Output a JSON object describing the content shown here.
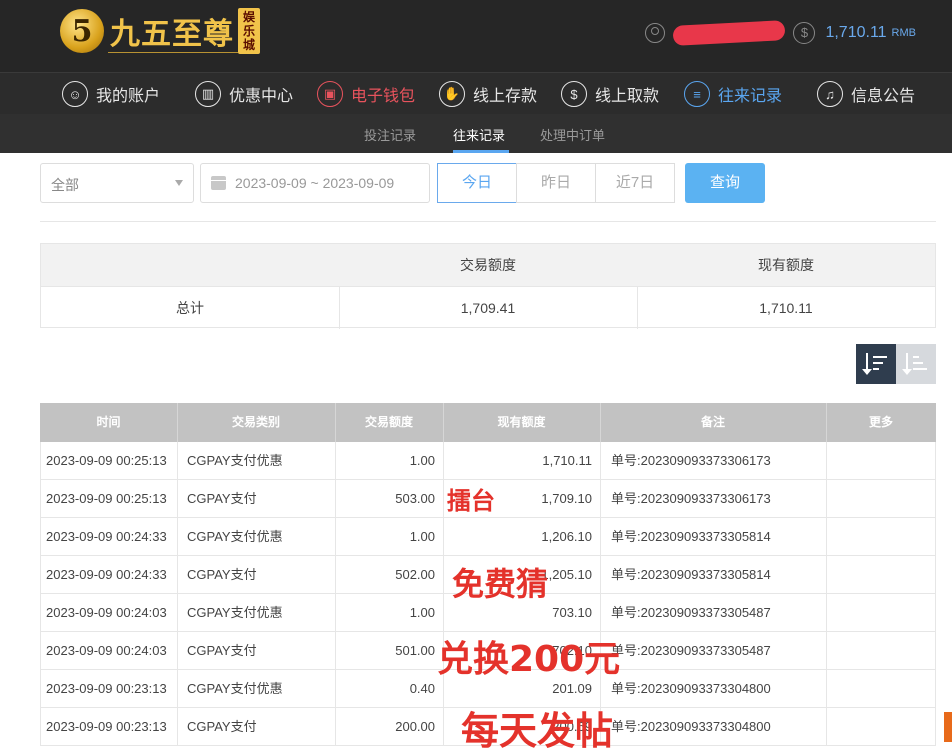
{
  "header": {
    "logo_mark": "5",
    "logo_text": "九五至尊",
    "logo_tag": "娱乐城",
    "balance": "1,710.11",
    "balance_unit": "RMB"
  },
  "nav": [
    {
      "label": "我的账户",
      "icon": "user-icon"
    },
    {
      "label": "优惠中心",
      "icon": "gift-icon"
    },
    {
      "label": "电子钱包",
      "icon": "wallet-icon"
    },
    {
      "label": "线上存款",
      "icon": "deposit-icon"
    },
    {
      "label": "线上取款",
      "icon": "withdraw-icon"
    },
    {
      "label": "往来记录",
      "icon": "record-icon"
    },
    {
      "label": "信息公告",
      "icon": "bell-icon"
    }
  ],
  "subnav": [
    "投注记录",
    "往来记录",
    "处理中订单"
  ],
  "filter": {
    "type_value": "全部",
    "date_range": "2023-09-09 ~ 2023-09-09",
    "today": "今日",
    "yesterday": "昨日",
    "last7": "近7日",
    "query": "查询"
  },
  "summary": {
    "headers": [
      "",
      "交易额度",
      "现有额度"
    ],
    "total_label": "总计",
    "trade_amount": "1,709.41",
    "current_amount": "1,710.11"
  },
  "table": {
    "headers": [
      "时间",
      "交易类别",
      "交易额度",
      "现有额度",
      "备注",
      "更多"
    ],
    "rows": [
      [
        "2023-09-09 00:25:13",
        "CGPAY支付优惠",
        "1.00",
        "1,710.11",
        "单号:202309093373306173",
        ""
      ],
      [
        "2023-09-09 00:25:13",
        "CGPAY支付",
        "503.00",
        "1,709.10",
        "单号:202309093373306173",
        ""
      ],
      [
        "2023-09-09 00:24:33",
        "CGPAY支付优惠",
        "1.00",
        "1,206.10",
        "单号:202309093373305814",
        ""
      ],
      [
        "2023-09-09 00:24:33",
        "CGPAY支付",
        "502.00",
        "1,205.10",
        "单号:202309093373305814",
        ""
      ],
      [
        "2023-09-09 00:24:03",
        "CGPAY支付优惠",
        "1.00",
        "703.10",
        "单号:202309093373305487",
        ""
      ],
      [
        "2023-09-09 00:24:03",
        "CGPAY支付",
        "501.00",
        "702.10",
        "单号:202309093373305487",
        ""
      ],
      [
        "2023-09-09 00:23:13",
        "CGPAY支付优惠",
        "0.40",
        "201.09",
        "单号:202309093373304800",
        ""
      ],
      [
        "2023-09-09 00:23:13",
        "CGPAY支付",
        "200.00",
        "200.69",
        "单号:202309093373304800",
        ""
      ]
    ]
  },
  "watermark": [
    "擂台",
    "免费猜",
    "兑换200元",
    "每天发帖"
  ]
}
